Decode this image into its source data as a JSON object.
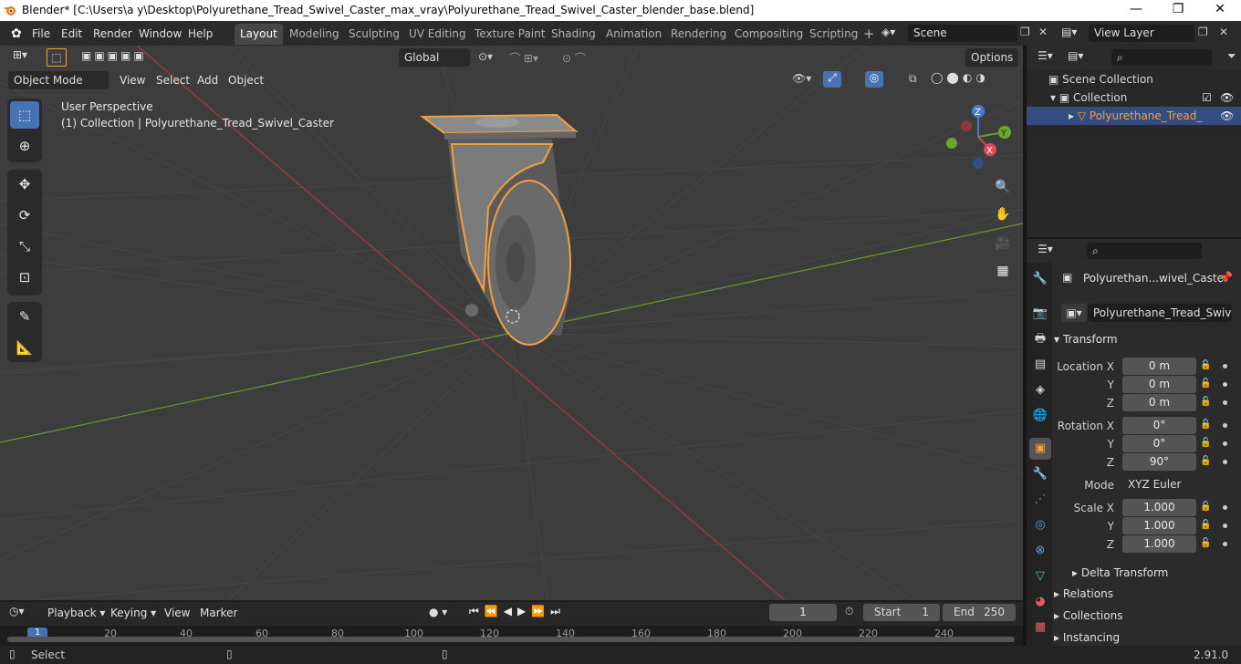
{
  "window": {
    "title": "Blender* [C:\\Users\\a y\\Desktop\\Polyurethane_Tread_Swivel_Caster_max_vray\\Polyurethane_Tread_Swivel_Caster_blender_base.blend]",
    "minimize": "—",
    "maximize": "❐",
    "close": "✕"
  },
  "menu": [
    "File",
    "Edit",
    "Render",
    "Window",
    "Help"
  ],
  "workspaces": [
    "Layout",
    "Modeling",
    "Sculpting",
    "UV Editing",
    "Texture Paint",
    "Shading",
    "Animation",
    "Rendering",
    "Compositing",
    "Scripting"
  ],
  "workspace_add": "+",
  "scene": {
    "label": "Scene"
  },
  "view_layer": {
    "label": "View Layer"
  },
  "viewport": {
    "transform_orientation": "Global",
    "options_label": "Options",
    "mode": "Object Mode",
    "menus": [
      "View",
      "Select",
      "Add",
      "Object"
    ],
    "overlay_line1": "User Perspective",
    "overlay_line2": "(1) Collection | Polyurethane_Tread_Swivel_Caster",
    "gizmo": {
      "x": "X",
      "y": "Y",
      "z": "Z"
    }
  },
  "outliner": {
    "scene_collection": "Scene Collection",
    "collection": "Collection",
    "object": "Polyurethane_Tread_"
  },
  "properties": {
    "object_name": "Polyurethan...wivel_Caster",
    "data_name": "Polyurethane_Tread_Swivel_...",
    "transform_header": "Transform",
    "location": {
      "label_x": "Location X",
      "label_y": "Y",
      "label_z": "Z",
      "x": "0 m",
      "y": "0 m",
      "z": "0 m"
    },
    "rotation": {
      "label_x": "Rotation X",
      "label_y": "Y",
      "label_z": "Z",
      "x": "0°",
      "y": "0°",
      "z": "90°"
    },
    "mode_label": "Mode",
    "mode_value": "XYZ Euler",
    "scale": {
      "label_x": "Scale X",
      "label_y": "Y",
      "label_z": "Z",
      "x": "1.000",
      "y": "1.000",
      "z": "1.000"
    },
    "delta_transform": "Delta Transform",
    "relations": "Relations",
    "collections": "Collections",
    "instancing": "Instancing"
  },
  "timeline": {
    "menus": [
      "Playback",
      "Keying",
      "View",
      "Marker"
    ],
    "current_frame": "1",
    "start_label": "Start",
    "start_value": "1",
    "end_label": "End",
    "end_value": "250",
    "ruler": [
      "1",
      "20",
      "40",
      "60",
      "80",
      "100",
      "120",
      "140",
      "160",
      "180",
      "200",
      "220",
      "240"
    ]
  },
  "status": {
    "left": "Select",
    "version": "2.91.0"
  },
  "colors": {
    "accent": "#4772b3",
    "selection": "#f2a03c",
    "x_axis": "#a33b3b",
    "y_axis": "#6b9a2d"
  }
}
